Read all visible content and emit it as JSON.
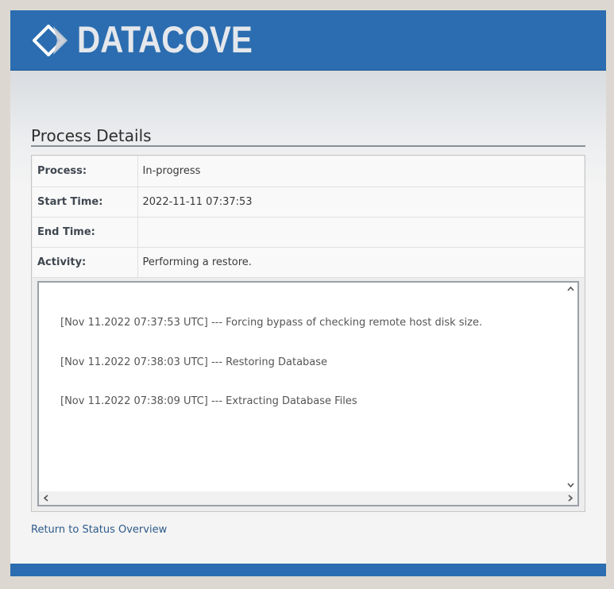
{
  "brand": {
    "name": "DATACOVE",
    "logo_icon": "diamond-logo-icon",
    "header_color": "#2b6db0"
  },
  "page": {
    "title": "Process Details"
  },
  "details": [
    {
      "label": "Process:",
      "value": "In-progress"
    },
    {
      "label": "Start Time:",
      "value": "2022-11-11 07:37:53"
    },
    {
      "label": "End Time:",
      "value": ""
    },
    {
      "label": "Activity:",
      "value": "Performing a restore."
    }
  ],
  "log": {
    "lines": [
      "[Nov 11.2022 07:37:53 UTC] --- Forcing bypass of checking remote host disk size.",
      "[Nov 11.2022 07:38:03 UTC] --- Restoring Database",
      "[Nov 11.2022 07:38:09 UTC] --- Extracting Database Files"
    ]
  },
  "links": {
    "return": "Return to Status Overview"
  }
}
